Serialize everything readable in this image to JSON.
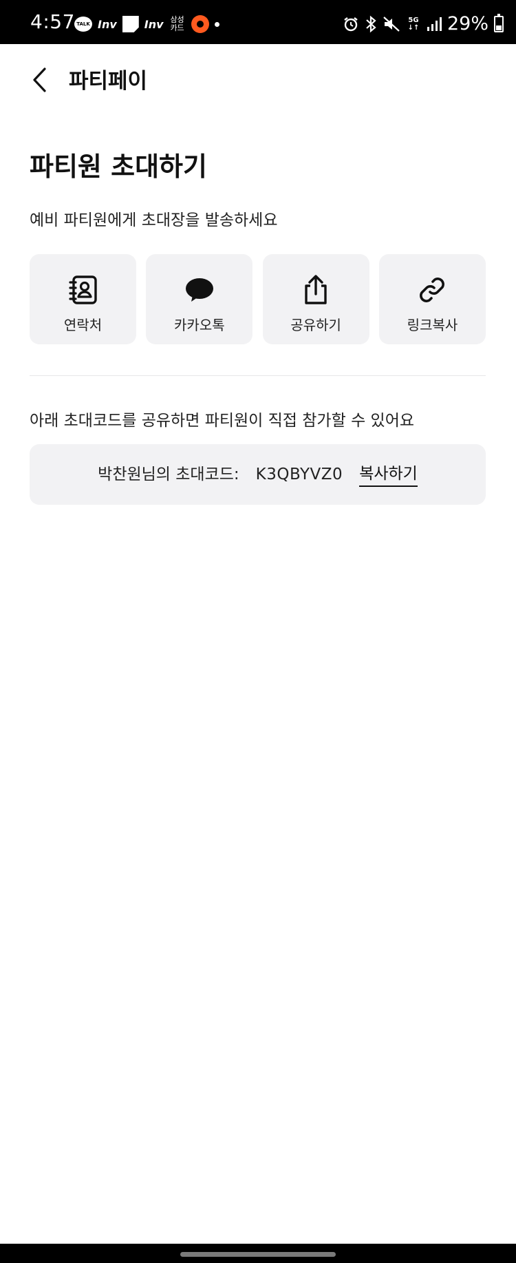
{
  "status_bar": {
    "time": "4:57",
    "left_icons": [
      "kakaotalk-icon",
      "inv-icon",
      "note-icon",
      "inv-icon",
      "samsung-card-icon",
      "record-icon",
      "dot-icon"
    ],
    "inv_label": "Inv",
    "talk_label": "TALK",
    "card_label_line1": "삼성",
    "card_label_line2": "카드",
    "network_label": "5G",
    "battery_percent": "29%"
  },
  "header": {
    "title": "파티페이"
  },
  "main": {
    "title": "파티원 초대하기",
    "subtitle": "예비 파티원에게 초대장을 발송하세요",
    "share_options": [
      {
        "label": "연락처",
        "icon": "contacts-icon"
      },
      {
        "label": "카카오톡",
        "icon": "kakaotalk-bubble-icon"
      },
      {
        "label": "공유하기",
        "icon": "share-icon"
      },
      {
        "label": "링크복사",
        "icon": "link-icon"
      }
    ],
    "code_description": "아래 초대코드를 공유하면 파티원이 직접 참가할 수 있어요",
    "invite_code": {
      "label": "박찬원님의 초대코드:",
      "value": "K3QBYVZ0",
      "copy_label": "복사하기"
    }
  },
  "colors": {
    "background": "#ffffff",
    "card_background": "#f2f2f4",
    "text": "#111111",
    "divider": "#e6e6e8",
    "status_bar": "#000000"
  }
}
